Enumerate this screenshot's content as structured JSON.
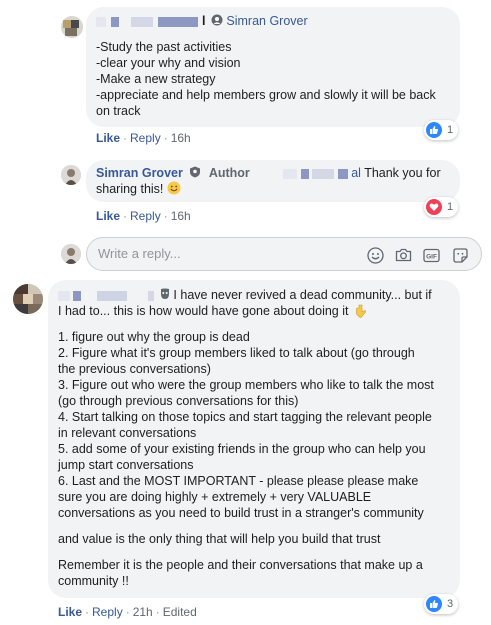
{
  "comments": [
    {
      "author_suffix": "l",
      "mention": "Simran Grover",
      "lines": [
        "-Study the past activities",
        "-clear your why and vision",
        "-Make a new strategy",
        "-appreciate and help members grow and slowly it will be back",
        "on track"
      ],
      "actions": {
        "like": "Like",
        "reply": "Reply",
        "time": "16h"
      },
      "reaction": {
        "icon": "like-reaction-icon",
        "color": "#2d88ff",
        "count": "1"
      }
    },
    {
      "author": "Simran Grover",
      "badge": "Author",
      "text_after": "al Thank you for",
      "line2": "sharing this!",
      "emoji": "smile-emoji-icon",
      "actions": {
        "like": "Like",
        "reply": "Reply",
        "time": "16h"
      },
      "reaction": {
        "icon": "love-reaction-icon",
        "color": "#f33e58",
        "count": "1"
      }
    },
    {
      "intro_lines": [
        "I have never revived a dead community... but if",
        "I had to... this is how would have gone about doing it"
      ],
      "list_lines": [
        "1. figure out why the group is dead",
        "2. Figure what it's group members liked to talk about (go through",
        "the previous conversations)",
        "3. Figure out who were the group members who like to talk the most",
        "(go through previous conversations for this)",
        "4. Start talking on those topics and start tagging the relevant people",
        "in relevant conversations",
        "5. add some of your existing friends in the group who can help you",
        "jump start conversations",
        "6. Last and the MOST IMPORTANT - please please please make",
        "sure you are doing highly + extremely + very VALUABLE",
        "conversations as you need to build trust in a stranger's community"
      ],
      "para2": "and value is the only thing that will help you build that trust",
      "para3_lines": [
        "Remember it is the people and their conversations that make up a",
        "community !!"
      ],
      "actions": {
        "like": "Like",
        "reply": "Reply",
        "time": "21h",
        "edited": "Edited"
      },
      "reaction": {
        "icon": "like-reaction-icon",
        "color": "#2d88ff",
        "count": "3"
      }
    }
  ],
  "reply_box": {
    "placeholder": "Write a reply..."
  },
  "colors": {
    "link": "#385898",
    "bubble": "#f2f3f5"
  }
}
